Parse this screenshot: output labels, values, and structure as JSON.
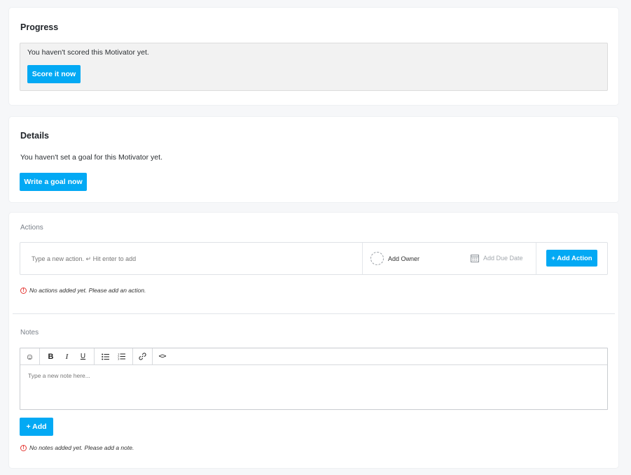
{
  "progress": {
    "title": "Progress",
    "message": "You haven't scored this Motivator yet.",
    "button_label": "Score it now"
  },
  "details": {
    "title": "Details",
    "message": "You haven't set a goal for this Motivator yet.",
    "button_label": "Write a goal now"
  },
  "actions": {
    "label": "Actions",
    "input_placeholder": "Type a new action. ↵ Hit enter to add",
    "owner_label": "Add Owner",
    "due_label": "Add Due Date",
    "add_button_label": "+ Add Action",
    "empty_message": "No actions added yet. Please add an action.",
    "warning_icon": "!"
  },
  "notes": {
    "label": "Notes",
    "toolbar": {
      "emoji": "☺",
      "bold": "B",
      "italic": "I",
      "underline": "U",
      "link": "🔗",
      "code": "<>"
    },
    "textarea_placeholder": "Type a new note here...",
    "add_button_label": "+ Add",
    "empty_message": "No notes added yet. Please add a note.",
    "warning_icon": "!"
  },
  "colors": {
    "accent": "#03a9f4",
    "warning": "#e53935",
    "page_bg": "#f6f7f9"
  }
}
